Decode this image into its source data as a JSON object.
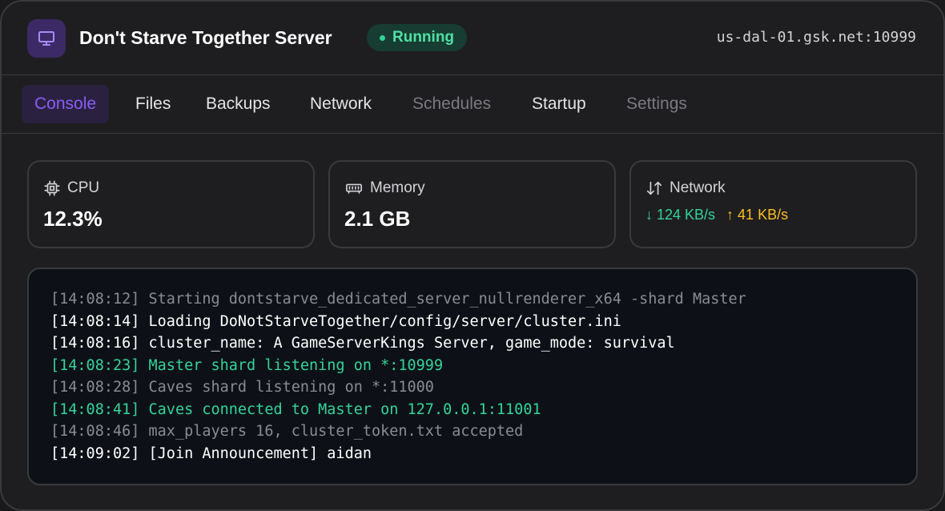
{
  "header": {
    "title": "Don't Starve Together Server",
    "status": "Running",
    "address": "us-dal-01.gsk.net:10999",
    "icon": "monitor-icon"
  },
  "tabs": [
    {
      "label": "Console",
      "state": "active"
    },
    {
      "label": "Files",
      "state": "normal"
    },
    {
      "label": "Backups",
      "state": "normal"
    },
    {
      "label": "Network",
      "state": "normal"
    },
    {
      "label": "Schedules",
      "state": "disabled"
    },
    {
      "label": "Startup",
      "state": "normal"
    },
    {
      "label": "Settings",
      "state": "disabled"
    }
  ],
  "stats": {
    "cpu": {
      "label": "CPU",
      "value": "12.3%",
      "icon": "cpu-icon"
    },
    "memory": {
      "label": "Memory",
      "value": "2.1 GB",
      "icon": "memory-icon"
    },
    "network": {
      "label": "Network",
      "down": "↓ 124 KB/s",
      "up": "↑ 41 KB/s",
      "icon": "network-arrows-icon"
    }
  },
  "console": {
    "lines": [
      {
        "time": "[14:08:12]",
        "text": "Starting dontstarve_dedicated_server_nullrenderer_x64 -shard Master",
        "level": "dim"
      },
      {
        "time": "[14:08:14]",
        "text": "Loading DoNotStarveTogether/config/server/cluster.ini",
        "level": "normal"
      },
      {
        "time": "[14:08:16]",
        "text": "cluster_name: A GameServerKings Server, game_mode: survival",
        "level": "normal"
      },
      {
        "time": "[14:08:23]",
        "text": "Master shard listening on *:10999",
        "level": "success"
      },
      {
        "time": "[14:08:28]",
        "text": "Caves shard listening on *:11000",
        "level": "dim"
      },
      {
        "time": "[14:08:41]",
        "text": "Caves connected to Master on 127.0.0.1:11001",
        "level": "success"
      },
      {
        "time": "[14:08:46]",
        "text": "max_players 16, cluster_token.txt accepted",
        "level": "dim"
      },
      {
        "time": "[14:09:02]",
        "text": "[Join Announcement] aidan",
        "level": "normal"
      }
    ]
  },
  "colors": {
    "accent": "#8b5cf6",
    "success": "#34d399",
    "warning": "#fbbf24",
    "background": "#1e1e20",
    "console_bg": "#0d1117"
  }
}
